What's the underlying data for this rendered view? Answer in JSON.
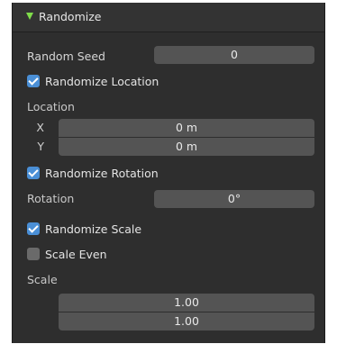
{
  "panel": {
    "title": "Randomize",
    "random_seed": {
      "label": "Random Seed",
      "value": "0"
    },
    "randomize_location": {
      "label": "Randomize Location",
      "checked": true
    },
    "location": {
      "label": "Location",
      "x": {
        "axis": "X",
        "value": "0 m"
      },
      "y": {
        "axis": "Y",
        "value": "0 m"
      }
    },
    "randomize_rotation": {
      "label": "Randomize Rotation",
      "checked": true
    },
    "rotation": {
      "label": "Rotation",
      "value": "0°"
    },
    "randomize_scale": {
      "label": "Randomize Scale",
      "checked": true
    },
    "scale_even": {
      "label": "Scale Even",
      "checked": false
    },
    "scale": {
      "label": "Scale",
      "values": [
        "1.00",
        "1.00"
      ]
    }
  },
  "colors": {
    "accent_checkbox": "#4a8fd6",
    "header_icon": "#7fdd4a",
    "panel_bg": "#2e2e2e",
    "field_bg": "#545454"
  }
}
